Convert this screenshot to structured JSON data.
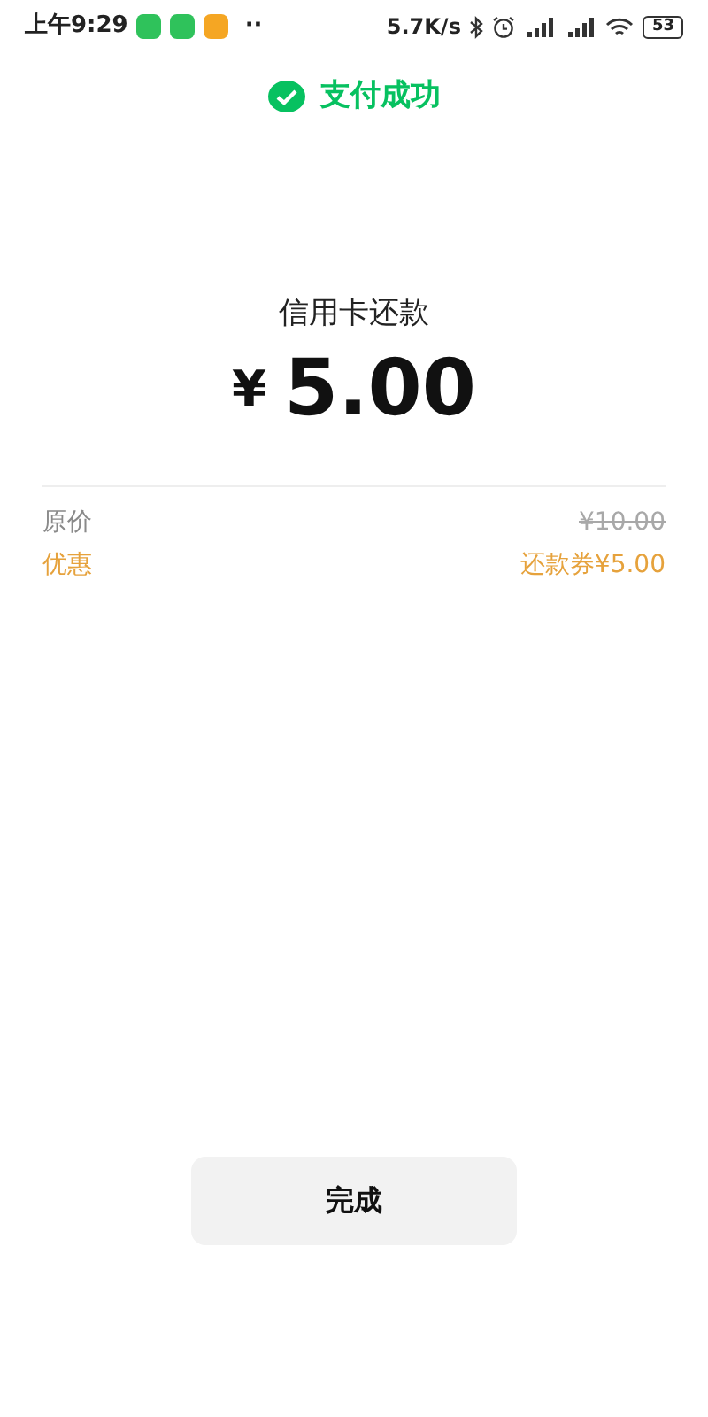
{
  "status_bar": {
    "time": "上午9:29",
    "notifications": [
      {
        "color": "#2fc25b"
      },
      {
        "color": "#2fc25b"
      },
      {
        "color": "#f5a623"
      }
    ],
    "more": "··",
    "speed": "5.7K/s",
    "battery": "53"
  },
  "header": {
    "title": "支付成功"
  },
  "payment": {
    "label": "信用卡还款",
    "currency": "¥",
    "amount": "5.00"
  },
  "details": [
    {
      "kind": "original",
      "label": "原价",
      "value": "¥10.00"
    },
    {
      "kind": "discount",
      "label": "优惠",
      "value": "还款券¥5.00"
    }
  ],
  "done_button": "完成"
}
